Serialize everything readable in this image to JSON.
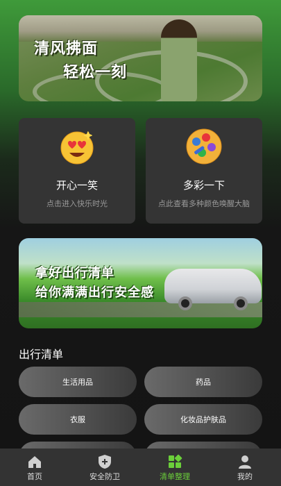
{
  "top_banner": {
    "line1": "清风拂面",
    "line2": "轻松一刻"
  },
  "cards": [
    {
      "title": "开心一笑",
      "subtitle": "点击进入快乐时光",
      "icon": "smile-heart-eyes-icon"
    },
    {
      "title": "多彩一下",
      "subtitle": "点此查看多种颜色唤醒大脑",
      "icon": "color-palette-icon"
    }
  ],
  "mid_banner": {
    "line1": "拿好出行清单",
    "line2": "给你满满出行安全感"
  },
  "section": {
    "title": "出行清单"
  },
  "checklist": [
    {
      "label": "生活用品"
    },
    {
      "label": "药品"
    },
    {
      "label": "衣服"
    },
    {
      "label": "化妆品护肤品"
    }
  ],
  "tabs": [
    {
      "label": "首页",
      "icon": "home-icon",
      "active": false
    },
    {
      "label": "安全防卫",
      "icon": "shield-plus-icon",
      "active": false
    },
    {
      "label": "清单整理",
      "icon": "grid-blocks-icon",
      "active": true
    },
    {
      "label": "我的",
      "icon": "user-icon",
      "active": false
    }
  ],
  "colors": {
    "accent": "#6bcf3a",
    "card_bg": "#343434",
    "tab_bg": "#333333"
  }
}
